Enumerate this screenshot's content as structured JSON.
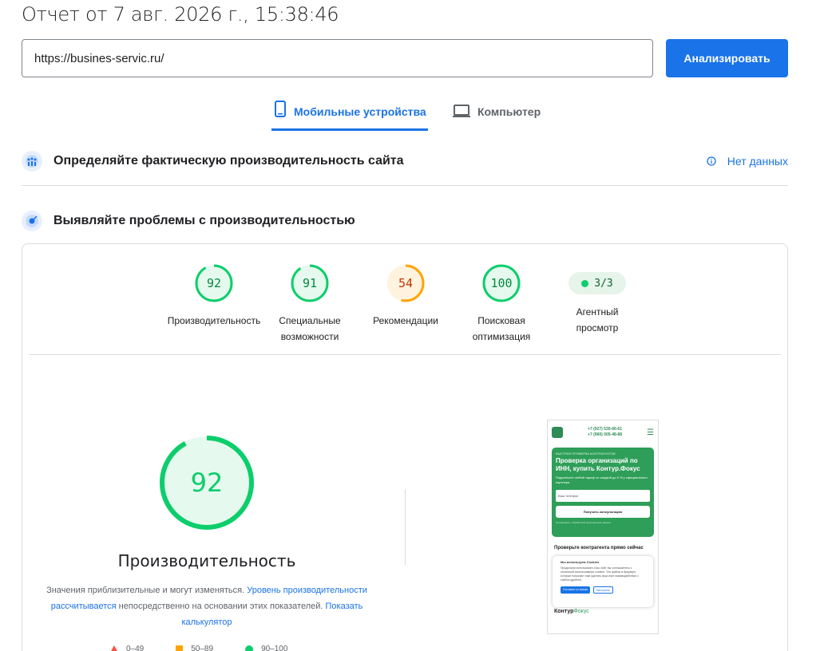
{
  "header": {
    "title": "Отчет от 7 авг. 2026 г., 15:38:46"
  },
  "search": {
    "url_value": "https://busines-servic.ru/",
    "analyze_label": "Анализировать"
  },
  "tabs": [
    {
      "label": "Мобильные устройства",
      "active": true,
      "icon": "smartphone-icon"
    },
    {
      "label": "Компьютер",
      "active": false,
      "icon": "laptop-icon"
    }
  ],
  "field_data": {
    "title": "Определяйте фактическую производительность сайта",
    "status": "Нет данных",
    "icon": "users-icon",
    "status_icon": "info-icon"
  },
  "lab_data": {
    "title": "Выявляйте проблемы с производительностью",
    "icon": "lighthouse-icon"
  },
  "scores": [
    {
      "label_line1": "Производительность",
      "label_line2": "",
      "score": 92,
      "level": "good"
    },
    {
      "label_line1": "Специальные",
      "label_line2": "возможности",
      "score": 91,
      "level": "good"
    },
    {
      "label_line1": "Рекомендации",
      "label_line2": "",
      "score": 54,
      "level": "average"
    },
    {
      "label_line1": "Поисковая",
      "label_line2": "оптимизация",
      "score": 100,
      "level": "good"
    }
  ],
  "agent": {
    "value": "3/3",
    "label_line1": "Агентный",
    "label_line2": "просмотр"
  },
  "performance": {
    "score": 92,
    "title": "Производительность",
    "desc_part1": "Значения приблизительные и могут изменяться. ",
    "desc_link1": "Уровень производительности рассчитывается",
    "desc_part2": " непосредственно на основании этих показателей. ",
    "desc_link2": "Показать калькулятор"
  },
  "legend": [
    {
      "shape": "triangle",
      "label": "0–49"
    },
    {
      "shape": "square",
      "label": "50–89"
    },
    {
      "shape": "circle",
      "label": "90–100"
    }
  ],
  "screenshot": {
    "phones_line1": "+7 (927) 530-66-61",
    "phones_line2": "+7 (960) 005-48-88",
    "hero_small": "БЫСТРАЯ ПРОВЕРКА КОНТРАГЕНТОВ",
    "hero_title": "Проверка организаций по ИНН, купить Контур.Фокус",
    "hero_text": "Подключите любой тариф со скидкой до 5 % у официального партнера",
    "input_placeholder": "Ваш телефон",
    "button": "Получить консультацию",
    "agree": "Соглашаюсь с обработкой персональных данных",
    "subheading": "Проверьте контрагента прямо сейчас",
    "cookie_title": "Мы используем Cookies",
    "cookie_text": "Продолжая использовать наш сайт, вы соглашаетесь с политикой использования cookies. Это файлы в браузере, которые помогают нам сделать ваш опыт взаимодействия с сайтом удобнее.",
    "cookie_ok": "Согласен со всеми",
    "cookie_settings": "Настроить",
    "brand_a": "Контур",
    "brand_b": "Фокус"
  },
  "colors": {
    "accent": "#1a73e8",
    "good": "#0cce6b",
    "average": "#ffa400",
    "bad": "#ff4e42"
  }
}
